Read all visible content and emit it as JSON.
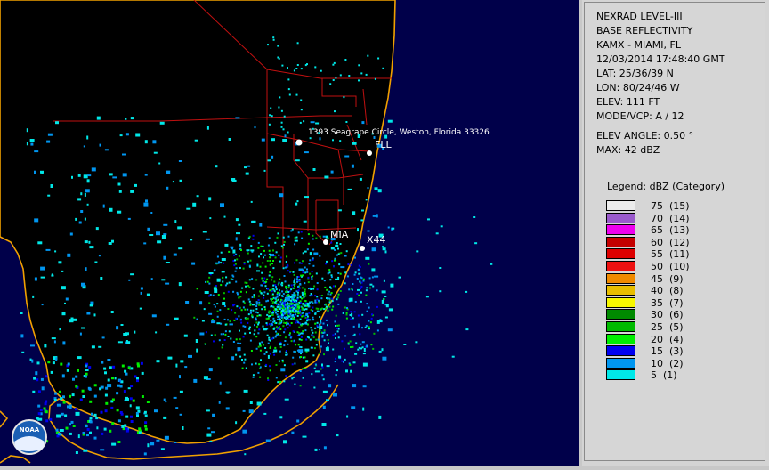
{
  "info": {
    "product": "NEXRAD LEVEL-III",
    "type": "BASE REFLECTIVITY",
    "station": "KAMX - MIAMI, FL",
    "datetime": "12/03/2014 17:48:40 GMT",
    "lat": "LAT: 25/36/39 N",
    "lon": "LON: 80/24/46 W",
    "elev": "ELEV: 111 FT",
    "mode": "MODE/VCP: A / 12",
    "elev_angle": "ELEV ANGLE: 0.50 °",
    "max": "MAX: 42 dBZ"
  },
  "legend": {
    "title": "Legend: dBZ (Category)",
    "items": [
      {
        "label": "75  (15)",
        "color": "#ececec"
      },
      {
        "label": "70  (14)",
        "color": "#9a5acc"
      },
      {
        "label": "65  (13)",
        "color": "#ee00ee"
      },
      {
        "label": "60  (12)",
        "color": "#c40000"
      },
      {
        "label": "55  (11)",
        "color": "#dd0000"
      },
      {
        "label": "50  (10)",
        "color": "#ee1111"
      },
      {
        "label": "45  (9)",
        "color": "#f08a00"
      },
      {
        "label": "40  (8)",
        "color": "#e8be00"
      },
      {
        "label": "35  (7)",
        "color": "#f7f700"
      },
      {
        "label": "30  (6)",
        "color": "#008a00"
      },
      {
        "label": "25  (5)",
        "color": "#00bb00"
      },
      {
        "label": "20  (4)",
        "color": "#00ee00"
      },
      {
        "label": "15  (3)",
        "color": "#0000f0"
      },
      {
        "label": "10  (2)",
        "color": "#0096f0"
      },
      {
        "label": "5  (1)",
        "color": "#00e8e8"
      }
    ]
  },
  "map": {
    "address_label": "1393 Seagrape Circle, Weston, Florida 33326",
    "fll_label": "FLL",
    "mia_label": "MIA",
    "x44_label": "X44",
    "logo": "NOAA",
    "colors": {
      "ocean": "#00004a",
      "land": "#000000",
      "coast": "#f0a000",
      "roads": "#c01010"
    }
  }
}
